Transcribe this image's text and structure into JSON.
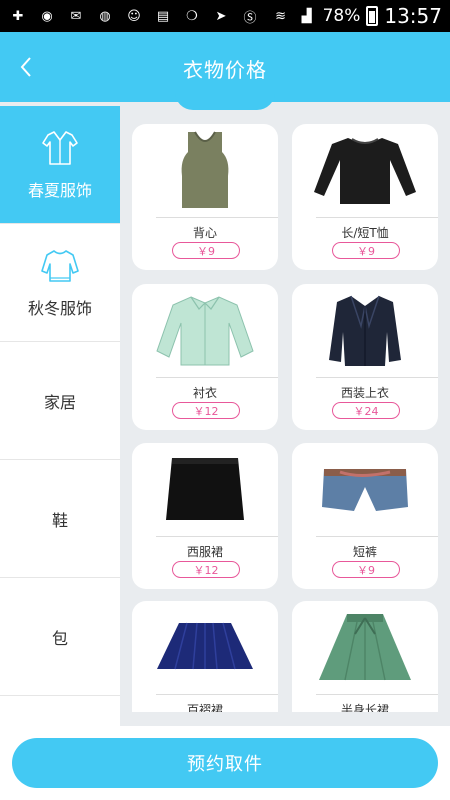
{
  "status_bar": {
    "battery": "78%",
    "time": "13:57"
  },
  "header": {
    "title": "衣物价格"
  },
  "sidebar": {
    "items": [
      {
        "label": "春夏服饰"
      },
      {
        "label": "秋冬服饰"
      },
      {
        "label": "家居"
      },
      {
        "label": "鞋"
      },
      {
        "label": "包"
      }
    ]
  },
  "products": [
    {
      "name": "背心",
      "price": "￥9"
    },
    {
      "name": "长/短T恤",
      "price": "￥9"
    },
    {
      "name": "衬衣",
      "price": "￥12"
    },
    {
      "name": "西装上衣",
      "price": "￥24"
    },
    {
      "name": "西服裙",
      "price": "￥12"
    },
    {
      "name": "短裤",
      "price": "￥9"
    },
    {
      "name": "百褶裙",
      "price": ""
    },
    {
      "name": "半身长裙",
      "price": ""
    }
  ],
  "footer": {
    "button_label": "预约取件"
  },
  "colors": {
    "accent": "#43c9f3",
    "price_pink": "#e8589a"
  }
}
